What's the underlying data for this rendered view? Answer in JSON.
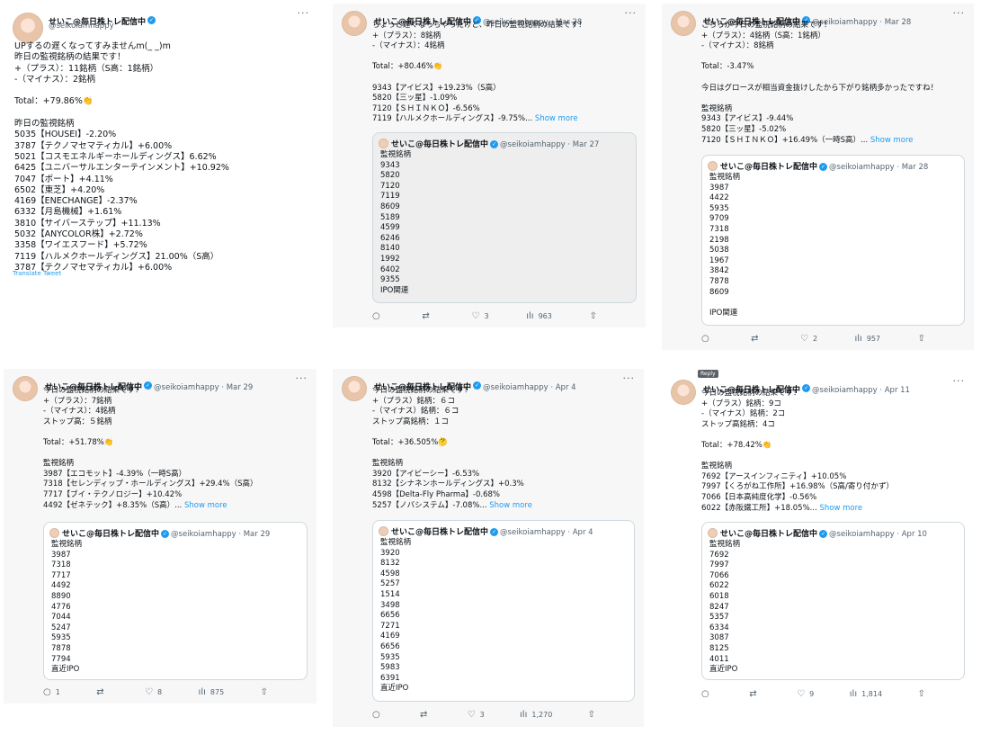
{
  "common": {
    "name": "せいこ@毎日株トレ配信中",
    "handle": "@seikoiamhappy",
    "show_more": "Show more",
    "translate": "Translate Tweet",
    "verified_glyph": "✓",
    "more_glyph": "···"
  },
  "icons": {
    "reply": "reply-icon",
    "retweet": "retweet-icon",
    "like": "heart-icon",
    "views": "views-icon",
    "share": "share-icon"
  },
  "tweet1": {
    "handle": "@seikoiamhappy",
    "text": "UPするの遅くなってすみませんm(_ _)m\n昨日の監視銘柄の結果です！\n+（プラス）：11銘柄（S高：1銘柄）\n-（マイナス）：2銘柄\n\nTotal：+79.86%👏\n\n昨日の監視銘柄\n5035【HOUSEI】-2.20%\n3787【テクノマセマティカル】+6.00%\n5021【コスモエネルギーホールディングス】6.62%\n6425【ユニバーサルエンターテインメント】+10.92%\n7047【ポート】+4.11%\n6502【東芝】+4.20%\n4169【ENECHANGE】-2.37%\n6332【月島機械】+1.61%\n3810【サイバーステップ】+11.13%\n5032【ANYCOLOR株】+2.72%\n3358【ワイエスフード】+5.72%\n7119【ハルメクホールディングス】21.00%（S高）\n3787【テクノマセマティカル】+6.00%"
  },
  "tweet2": {
    "meta": "@seikoiamhappy · Mar 28",
    "text": "ちょっと遅くなっちゃったけど、昨日の監視銘柄の結果です！\n+（プラス）：8銘柄\n-（マイナス）：4銘柄\n\nTotal：+80.46%👏\n\n9343【アイビス】+19.23%（S高）\n5820【三ッ星】-1.09%\n7120【ＳＨＩＮＫＯ】-6.56%\n7119【ハルメクホールディングス】-9.75%...",
    "quote_meta": "@seikoiamhappy · Mar 27",
    "quote_text": "監視銘柄\n9343\n5820\n7120\n7119\n8609\n5189\n4599\n6246\n8140\n1992\n6402\n9355\nIPO関連",
    "replies": "",
    "retweets": "",
    "likes": "3",
    "views": "963"
  },
  "tweet3": {
    "meta": "@seikoiamhappy · Mar 28",
    "text": "こちらが今日の監視銘柄の結果です！\n+（プラス）：4銘柄（S高：1銘柄）\n-（マイナス）：8銘柄\n\nTotal：-3.47%\n\n今日はグロースが相当資金抜けしたから下がり銘柄多かったですね！\n\n監視銘柄\n9343【アイビス】-9.44%\n5820【三ッ星】-5.02%\n7120【ＳＨＩＮＫＯ】+16.49%（一時S高）...",
    "quote_meta": "@seikoiamhappy · Mar 28",
    "quote_text": "監視銘柄\n3987\n4422\n5935\n9709\n7318\n2198\n5038\n1967\n3842\n7878\n8609\n\nIPO関連",
    "replies": "",
    "retweets": "",
    "likes": "2",
    "views": "957"
  },
  "tweet4": {
    "meta": "@seikoiamhappy · Mar 29",
    "text": "今日の監視銘柄の結果です！\n+（プラス）：7銘柄\n-（マイナス）：4銘柄\nストップ高：５銘柄\n\nTotal：+51.78%👏\n\n監視銘柄\n3987【エコモット】-4.39%（一時S高）\n7318【セレンディップ・ホールディングス】+29.4%（S高）\n7717【ブイ・テクノロジー】+10.42%\n4492【ゼネテック】+8.35%（S高）...",
    "quote_meta": "@seikoiamhappy · Mar 29",
    "quote_text": "監視銘柄\n3987\n7318\n7717\n4492\n8890\n4776\n7044\n5247\n5935\n7878\n7794\n直近IPO",
    "replies": "1",
    "retweets": "",
    "likes": "8",
    "views": "875"
  },
  "tweet5": {
    "meta": "@seikoiamhappy · Apr 4",
    "text": "今日の監視銘柄の結果です！\n+（プラス）銘柄：６コ\n-（マイナス）銘柄：６コ\nストップ高銘柄：１コ\n\nTotal：+36.505%🤔\n\n監視銘柄\n3920【アイビーシー】-6.53%\n8132【シナネンホールディングス】+0.3%\n4598【Delta-Fly Pharma】-0.68%\n5257【ノバシステム】-7.08%...",
    "quote_meta": "@seikoiamhappy · Apr 4",
    "quote_text": "監視銘柄\n3920\n8132\n4598\n5257\n1514\n3498\n6656\n7271\n4169\n6656\n5935\n5983\n6391\n直近IPO",
    "replies": "",
    "retweets": "",
    "likes": "3",
    "views": "1,270"
  },
  "tweet6": {
    "tooltip": "Reply",
    "meta": "@seikoiamhappy · Apr 11",
    "text": "今日の監視銘柄の結果です！\n+（プラス）銘柄：9コ\n-（マイナス）銘柄：2コ\nストップ高銘柄：4コ\n\nTotal：+78.42%👏\n\n監視銘柄\n7692【アースインフィニティ】+10.05%\n7997【くろがね工作所】+16.98%（S高/寄り付かず）\n7066【日本高純度化学】-0.56%\n6022【赤阪鐵工所】+18.05%...",
    "quote_meta": "@seikoiamhappy · Apr 10",
    "quote_text": "監視銘柄\n7692\n7997\n7066\n6022\n6018\n8247\n5357\n6334\n3087\n8125\n4011\n直近IPO",
    "replies": "",
    "retweets": "",
    "likes": "9",
    "views": "1,814"
  }
}
